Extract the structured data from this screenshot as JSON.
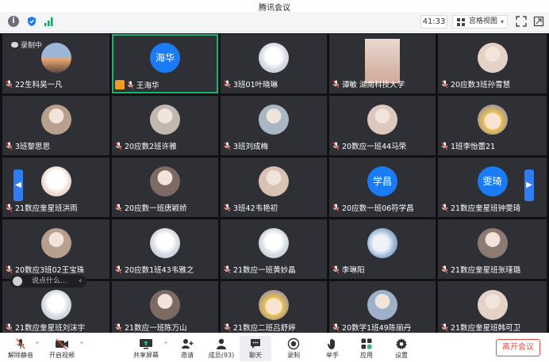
{
  "app": {
    "title": "腾讯会议"
  },
  "topbar": {
    "timer": "41:33",
    "view_mode": "宫格视图"
  },
  "recording": {
    "label": "录制中"
  },
  "grid": {
    "tiles": [
      {
        "name": "22生科吴一凡",
        "avatar": "photo-sunset"
      },
      {
        "name": "王海华",
        "avatar_text": "海华",
        "host": true,
        "active": true
      },
      {
        "name": "3班01叶晓琳",
        "avatar": "cartoon"
      },
      {
        "name": "谭敏 湖南科技大学",
        "avatar": "camera-live"
      },
      {
        "name": "20应数3班孙雪慧",
        "avatar": "photo"
      },
      {
        "name": "3班黎思思",
        "avatar": "photo"
      },
      {
        "name": "20应数2班许雅",
        "avatar": "photo"
      },
      {
        "name": "3班刘成梅",
        "avatar": "photo"
      },
      {
        "name": "20数应一班44马荣",
        "avatar": "photo"
      },
      {
        "name": "1班李怡蕾21",
        "avatar": "anime"
      },
      {
        "name": "21数应奎星班洪雨",
        "avatar": "photo-cat"
      },
      {
        "name": "20应数一班唐颖娇",
        "avatar": "photo"
      },
      {
        "name": "3班42韦艳初",
        "avatar": "photo"
      },
      {
        "name": "20应数一班06符学昌",
        "avatar_text": "学昌"
      },
      {
        "name": "21数应奎星班钟雯琦",
        "avatar_text": "雯琦"
      },
      {
        "name": "20数应3班02王宝珠",
        "avatar": "photo"
      },
      {
        "name": "20应数1班43韦雅之",
        "avatar": "cartoon"
      },
      {
        "name": "21数应一班黄妙晶",
        "avatar": "cartoon"
      },
      {
        "name": "李琳阳",
        "avatar": "photo-sky"
      },
      {
        "name": "21数应奎星班张瑾璐",
        "avatar": "photo"
      },
      {
        "name": "21数应奎星班刘沫宇",
        "avatar": "cartoon-rabbit"
      },
      {
        "name": "21数应一班陈万山",
        "avatar": "photo"
      },
      {
        "name": "21数应二班吕舒婷",
        "avatar": "anime"
      },
      {
        "name": "20数学1班49陈丽丹",
        "avatar": "photo"
      },
      {
        "name": "21数应奎星班韩可卫",
        "avatar": "photo"
      }
    ]
  },
  "chat_input": {
    "placeholder": "说点什么..."
  },
  "toolbar": {
    "mute": "解除静音",
    "video": "开启视频",
    "share": "共享屏幕",
    "invite": "邀请",
    "members": "成员(93)",
    "chat": "聊天",
    "record": "录制",
    "raise_hand": "举手",
    "apps": "应用",
    "settings": "设置",
    "leave": "离开会议"
  },
  "colors": {
    "accent": "#1a7cf5",
    "active_border": "#17b46a",
    "leave": "#e94b3c",
    "tile_bg": "#2e3036"
  }
}
